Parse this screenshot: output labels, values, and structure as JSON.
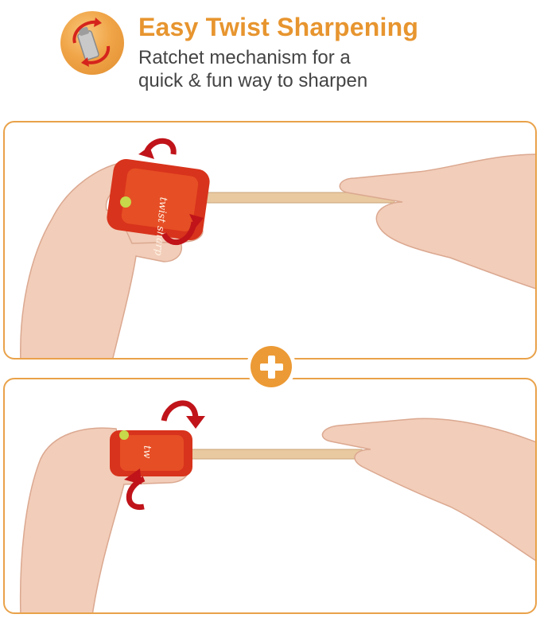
{
  "header": {
    "title": "Easy Twist Sharpening",
    "subtitle_line1": "Ratchet mechanism for a",
    "subtitle_line2": "quick & fun way to sharpen",
    "icon": "sharpener-twist-icon"
  },
  "panels": [
    {
      "brand_text": "twist sharp"
    },
    {
      "brand_text": "tw"
    }
  ],
  "divider_icon": "plus-icon",
  "colors": {
    "accent": "#e7952f",
    "panel_border": "#e9a24a",
    "sharpener_red": "#d8331c",
    "arrow_red": "#c0141a",
    "pencil": "#e9c9a0",
    "skin": "#f2cdb9",
    "text_dark": "#444444"
  }
}
